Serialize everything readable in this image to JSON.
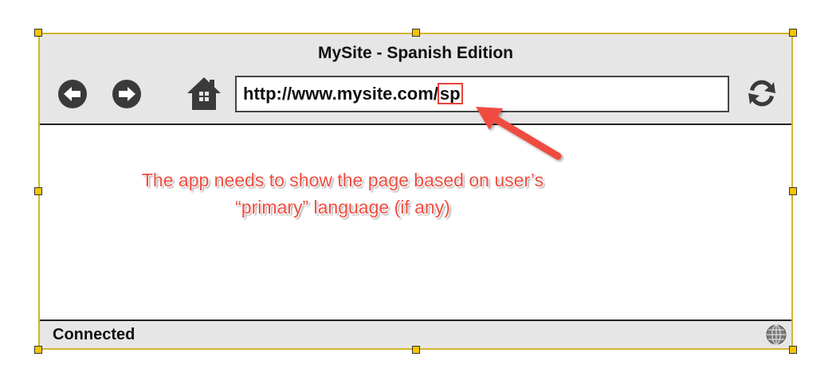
{
  "window": {
    "title": "MySite - Spanish Edition"
  },
  "toolbar": {
    "back_icon": "back-arrow-circle",
    "forward_icon": "forward-arrow-circle",
    "home_icon": "home",
    "refresh_icon": "refresh"
  },
  "address_bar": {
    "url_base": "http://www.mysite.com/",
    "url_highlight": "sp"
  },
  "annotation": {
    "line1": "The app needs to show the page based on user’s",
    "line2": "“primary” language (if any)",
    "color": "#f04c40"
  },
  "status_bar": {
    "text": "Connected",
    "icon": "globe"
  },
  "colors": {
    "selection_border": "#d4b62a",
    "handle_fill": "#f5c400",
    "chrome_bg": "#e6e6e6"
  }
}
